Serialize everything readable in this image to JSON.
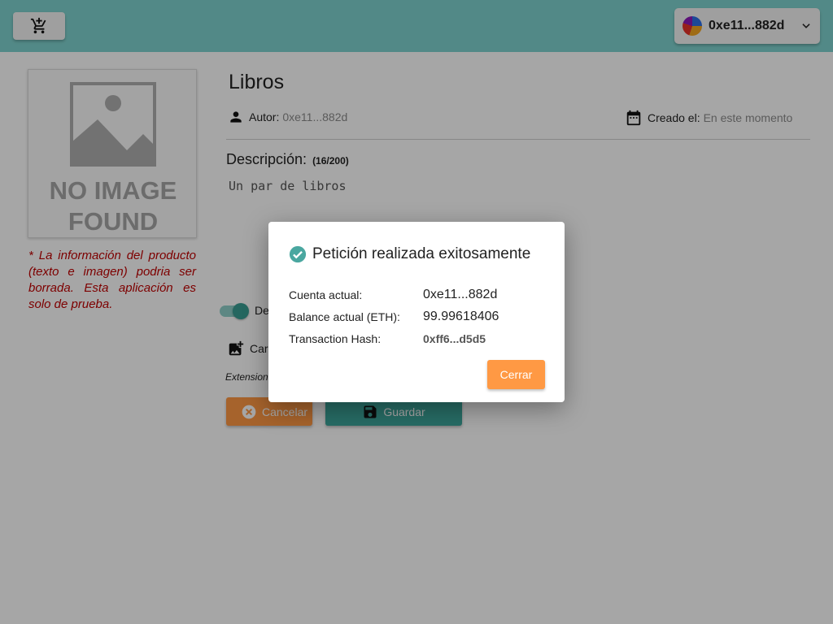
{
  "header": {
    "cart_icon": "add-shopping-cart-icon",
    "account_label": "0xe11...882d",
    "account_icon": "chevron-down-icon"
  },
  "product": {
    "image_placeholder": "NO IMAGE FOUND",
    "disclaimer": "* La información del producto (texto e imagen) podria ser borrada. Esta aplicación es solo de prueba.",
    "title": "Libros",
    "author_label": "Autor:",
    "author_value": "0xe11...882d",
    "created_label": "Creado el:",
    "created_value": "En este momento",
    "description_label": "Descripción:",
    "description_count": "(16/200)",
    "description_text": "Un par de libros",
    "toggle_label": "De",
    "upload_label": "Carg",
    "extension_text": "Extension",
    "cancel_label": "Cancelar",
    "save_label": "Guardar"
  },
  "modal": {
    "title": "Petición realizada exitosamente",
    "rows": [
      {
        "label": "Cuenta actual:",
        "value": "0xe11...882d"
      },
      {
        "label": "Balance actual (ETH):",
        "value": "99.99618406"
      },
      {
        "label": "Transaction Hash:",
        "value": "0xff6...d5d5"
      }
    ],
    "close_label": "Cerrar"
  },
  "colors": {
    "topbar": "#7fd3cf",
    "accent_teal": "#3da79c",
    "accent_orange": "#ff9944",
    "disclaimer_red": "#c00000"
  }
}
